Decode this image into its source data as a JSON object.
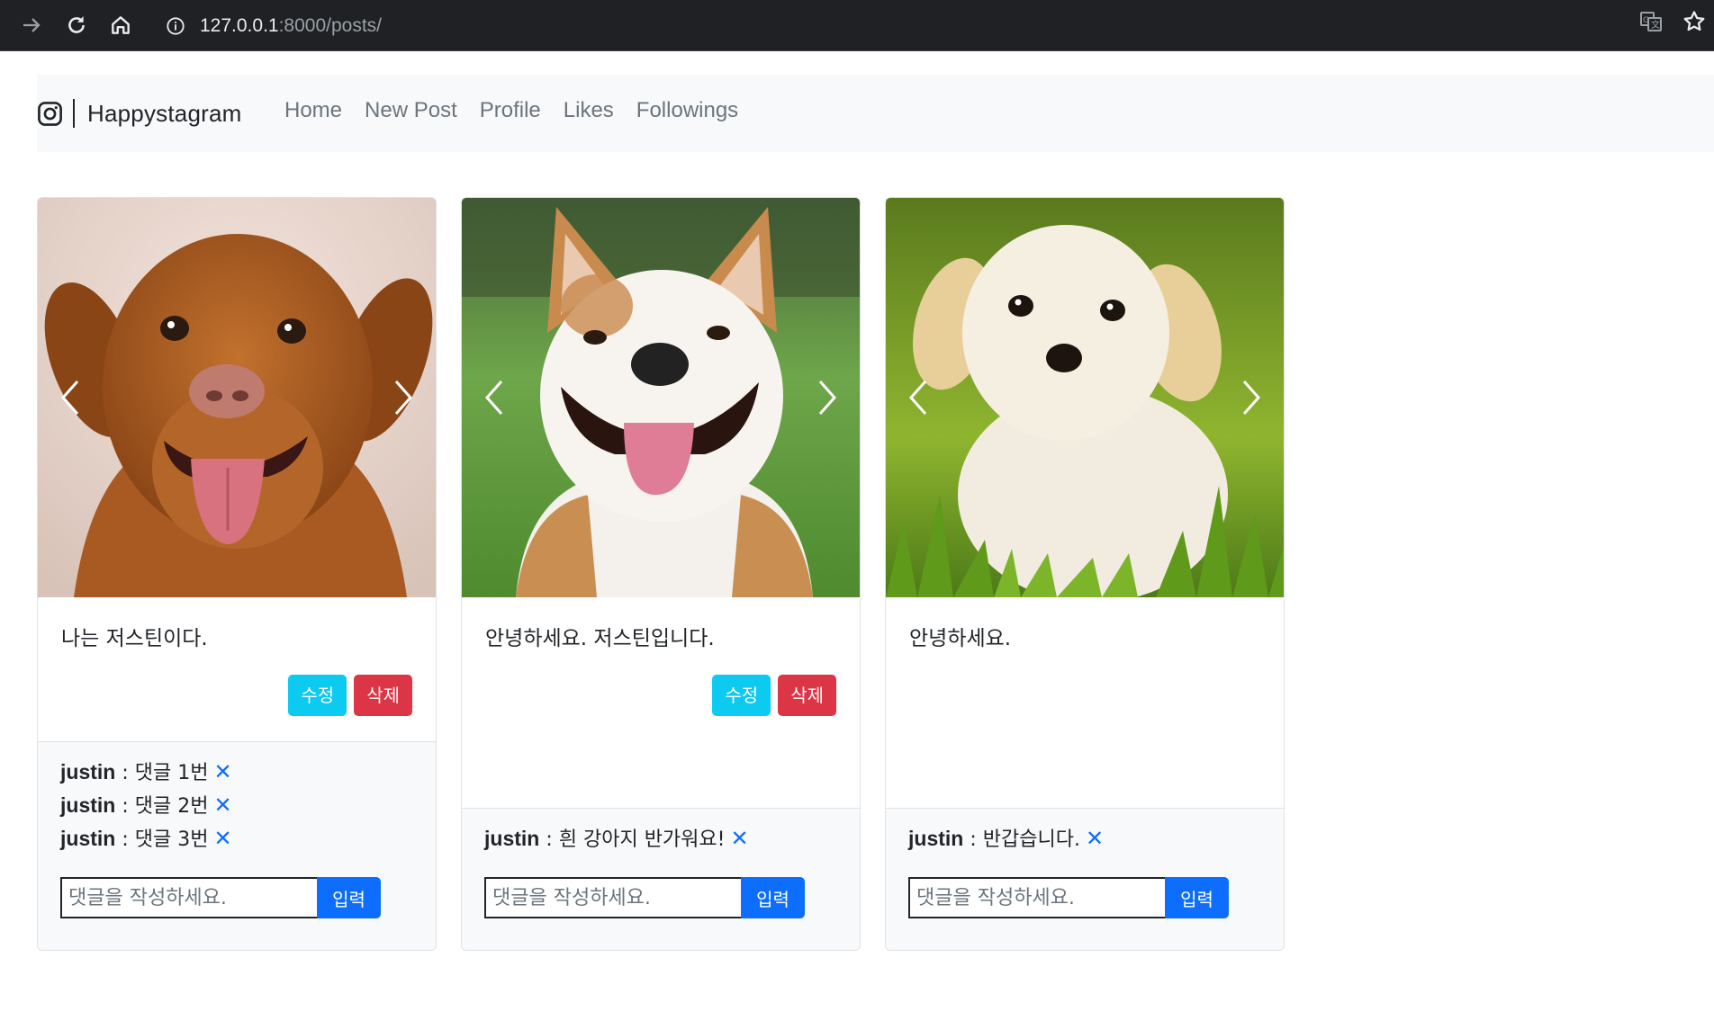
{
  "browser": {
    "url_host": "127.0.0.1",
    "url_path": ":8000/posts/",
    "icons": [
      "forward-icon",
      "reload-icon",
      "home-icon",
      "info-icon",
      "translate-icon",
      "star-icon"
    ]
  },
  "navbar": {
    "brand": "Happystagram",
    "links": [
      "Home",
      "New Post",
      "Profile",
      "Likes",
      "Followings"
    ]
  },
  "buttons": {
    "edit": "수정",
    "delete": "삭제",
    "submit": "입력"
  },
  "comment_placeholder": "댓글을 작성하세요.",
  "posts": [
    {
      "caption": "나는 저스틴이다.",
      "has_actions": true,
      "comments": [
        {
          "user": "justin",
          "sep": " : ",
          "text": "댓글 1번",
          "delete": "✕"
        },
        {
          "user": "justin",
          "sep": " : ",
          "text": "댓글 2번",
          "delete": "✕"
        },
        {
          "user": "justin",
          "sep": " : ",
          "text": "댓글 3번",
          "delete": "✕"
        }
      ]
    },
    {
      "caption": "안녕하세요. 저스틴입니다.",
      "has_actions": true,
      "comments": [
        {
          "user": "justin",
          "sep": " : ",
          "text": "흰 강아지 반가워요!",
          "delete": "✕"
        }
      ]
    },
    {
      "caption": "안녕하세요.",
      "has_actions": false,
      "comments": [
        {
          "user": "justin",
          "sep": " : ",
          "text": "반갑습니다.",
          "delete": "✕"
        }
      ]
    }
  ],
  "colors": {
    "info": "#0dcaf0",
    "danger": "#dc3545",
    "primary": "#0d6efd",
    "navbar_bg": "#f8f9fa"
  }
}
